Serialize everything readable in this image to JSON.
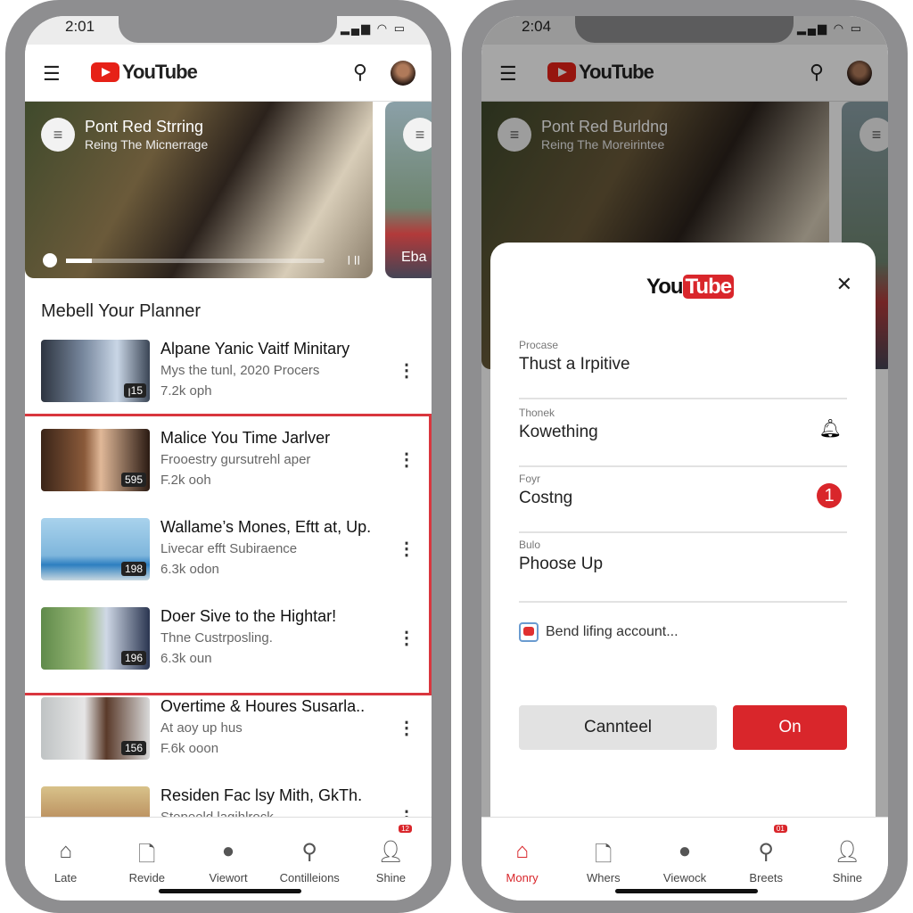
{
  "left": {
    "time": "2:01",
    "brand": "YouTube",
    "hero": {
      "title": "Pont Red Strring",
      "subtitle": "Reing The Micnerrage",
      "side_label": "Eba",
      "quality": "ꞁ ꞁꞁ"
    },
    "section_title": "Mebell Your Planner",
    "videos": [
      {
        "title": "Alpane Yanic Vaitf  Minitary",
        "subtitle": "Mys the tunl, 2020 Procers",
        "views": "7.2k oph",
        "duration": "ꞁ15"
      },
      {
        "title": "Malice You Time Jarlver",
        "subtitle": "Frooestry gursutrehl aper",
        "views": "F.2k ooh",
        "duration": "595"
      },
      {
        "title": "Wallame’s Mones, Eftt at, Up.",
        "subtitle": "Livecar efft Subiraence",
        "views": "6.3k odon",
        "duration": "198"
      },
      {
        "title": "Doer Sive to the Hightar!",
        "subtitle": "Thne Custrposling.",
        "views": "6.3k oun",
        "duration": "196"
      },
      {
        "title": "Overtime & Houres Susarla..",
        "subtitle": "At aoy up hus",
        "views": "F.6k ooon",
        "duration": "156"
      },
      {
        "title": "Residen Fac lsy Mith, GkTh.",
        "subtitle": "Stepeeld lagihlrock",
        "views": "",
        "duration": ""
      }
    ],
    "nav": [
      {
        "label": "Late",
        "icon": "home-icon"
      },
      {
        "label": "Revide",
        "icon": "document-icon"
      },
      {
        "label": "Viewort",
        "icon": "circle-icon"
      },
      {
        "label": "Contilleions",
        "icon": "search-icon"
      },
      {
        "label": "Shine",
        "icon": "person-icon",
        "badge": "12"
      }
    ]
  },
  "right": {
    "time": "2:04",
    "brand": "YouTube",
    "hero": {
      "title": "Pont Red Burldng",
      "subtitle": "Reing The Moreirintee"
    },
    "modal": {
      "logo_you": "You",
      "logo_tube": "Tube",
      "fields": [
        {
          "label": "Procase",
          "value": "Thust a Irpitive"
        },
        {
          "label": "Thonek",
          "value": "Kowething"
        },
        {
          "label": "Foyr",
          "value": "Costng",
          "badge": "1"
        },
        {
          "label": "Bulo",
          "value": "Phoose Up"
        }
      ],
      "checkbox_label": "Bend lifing account...",
      "cancel": "Canntеel",
      "confirm": "On"
    },
    "nav": [
      {
        "label": "Monry",
        "icon": "home-icon",
        "active": true
      },
      {
        "label": "Whers",
        "icon": "document-icon"
      },
      {
        "label": "Viewock",
        "icon": "circle-icon"
      },
      {
        "label": "Breets",
        "icon": "search-icon",
        "badge": "01"
      },
      {
        "label": "Shine",
        "icon": "person-icon"
      }
    ]
  },
  "colors": {
    "accent": "#d9262b",
    "highlight": "#d9363e"
  }
}
